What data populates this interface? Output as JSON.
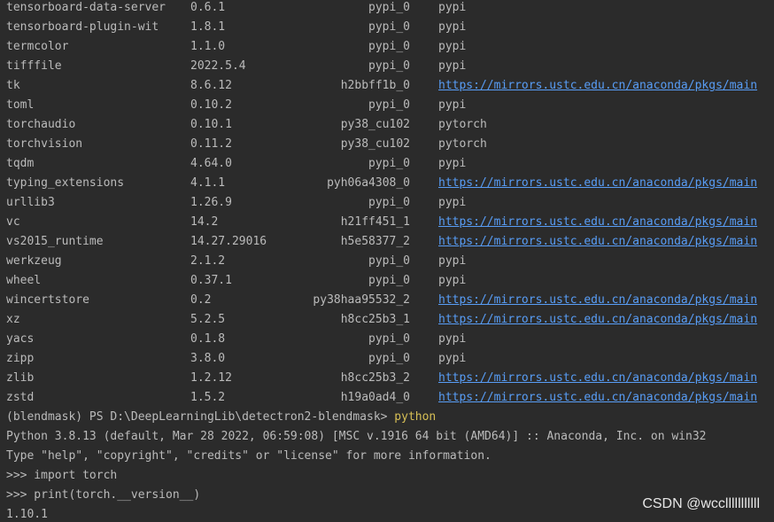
{
  "packages": [
    {
      "name": "tensorboard-data-server",
      "version": "0.6.1",
      "build": "pypi_0",
      "channel": "pypi",
      "is_link": false
    },
    {
      "name": "tensorboard-plugin-wit",
      "version": "1.8.1",
      "build": "pypi_0",
      "channel": "pypi",
      "is_link": false
    },
    {
      "name": "termcolor",
      "version": "1.1.0",
      "build": "pypi_0",
      "channel": "pypi",
      "is_link": false
    },
    {
      "name": "tifffile",
      "version": "2022.5.4",
      "build": "pypi_0",
      "channel": "pypi",
      "is_link": false
    },
    {
      "name": "tk",
      "version": "8.6.12",
      "build": "h2bbff1b_0",
      "channel": "https://mirrors.ustc.edu.cn/anaconda/pkgs/main",
      "is_link": true
    },
    {
      "name": "toml",
      "version": "0.10.2",
      "build": "pypi_0",
      "channel": "pypi",
      "is_link": false
    },
    {
      "name": "torchaudio",
      "version": "0.10.1",
      "build": "py38_cu102",
      "channel": "pytorch",
      "is_link": false
    },
    {
      "name": "torchvision",
      "version": "0.11.2",
      "build": "py38_cu102",
      "channel": "pytorch",
      "is_link": false
    },
    {
      "name": "tqdm",
      "version": "4.64.0",
      "build": "pypi_0",
      "channel": "pypi",
      "is_link": false
    },
    {
      "name": "typing_extensions",
      "version": "4.1.1",
      "build": "pyh06a4308_0",
      "channel": "https://mirrors.ustc.edu.cn/anaconda/pkgs/main",
      "is_link": true
    },
    {
      "name": "urllib3",
      "version": "1.26.9",
      "build": "pypi_0",
      "channel": "pypi",
      "is_link": false
    },
    {
      "name": "vc",
      "version": "14.2",
      "build": "h21ff451_1",
      "channel": "https://mirrors.ustc.edu.cn/anaconda/pkgs/main",
      "is_link": true
    },
    {
      "name": "vs2015_runtime",
      "version": "14.27.29016",
      "build": "h5e58377_2",
      "channel": "https://mirrors.ustc.edu.cn/anaconda/pkgs/main",
      "is_link": true
    },
    {
      "name": "werkzeug",
      "version": "2.1.2",
      "build": "pypi_0",
      "channel": "pypi",
      "is_link": false
    },
    {
      "name": "wheel",
      "version": "0.37.1",
      "build": "pypi_0",
      "channel": "pypi",
      "is_link": false
    },
    {
      "name": "wincertstore",
      "version": "0.2",
      "build": "py38haa95532_2",
      "channel": "https://mirrors.ustc.edu.cn/anaconda/pkgs/main",
      "is_link": true
    },
    {
      "name": "xz",
      "version": "5.2.5",
      "build": "h8cc25b3_1",
      "channel": "https://mirrors.ustc.edu.cn/anaconda/pkgs/main",
      "is_link": true
    },
    {
      "name": "yacs",
      "version": "0.1.8",
      "build": "pypi_0",
      "channel": "pypi",
      "is_link": false
    },
    {
      "name": "zipp",
      "version": "3.8.0",
      "build": "pypi_0",
      "channel": "pypi",
      "is_link": false
    },
    {
      "name": "zlib",
      "version": "1.2.12",
      "build": "h8cc25b3_2",
      "channel": "https://mirrors.ustc.edu.cn/anaconda/pkgs/main",
      "is_link": true
    },
    {
      "name": "zstd",
      "version": "1.5.2",
      "build": "h19a0ad4_0",
      "channel": "https://mirrors.ustc.edu.cn/anaconda/pkgs/main",
      "is_link": true
    }
  ],
  "console": {
    "prompt": "(blendmask) PS D:\\DeepLearningLib\\detectron2-blendmask> ",
    "command": "python",
    "python_banner": "Python 3.8.13 (default, Mar 28 2022, 06:59:08) [MSC v.1916 64 bit (AMD64)] :: Anaconda, Inc. on win32",
    "help_line": "Type \"help\", \"copyright\", \"credits\" or \"license\" for more information.",
    "repl_line_1": ">>> import torch",
    "repl_line_2": ">>> print(torch.__version__)",
    "output": "1.10.1"
  },
  "watermark": "CSDN @wcclllllllllll",
  "colors": {
    "background": "#2b2b2b",
    "text": "#bbbbbb",
    "link": "#589df6",
    "command": "#d6bf55"
  }
}
